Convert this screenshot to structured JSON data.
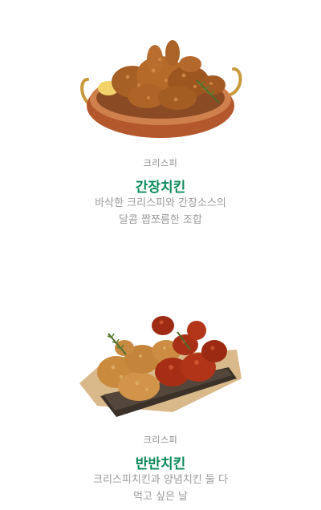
{
  "menu_items": [
    {
      "category": "크리스피",
      "name": "간장치킨",
      "description_line1": "바삭한 크리스피와 간장소스의",
      "description_line2": "달콤 짭쪼름한 조합",
      "image_icon": "soy-chicken-in-copper-pan-image"
    },
    {
      "category": "크리스피",
      "name": "반반치킨",
      "description_line1": "크리스피치킨과 양념치킨 둘 다",
      "description_line2": "먹고 싶은 날",
      "image_icon": "half-half-chicken-on-tray-image"
    }
  ],
  "colors": {
    "title_green": "#0b8a5b",
    "category_gray": "#8a8a8a",
    "description_gray": "#9a9a9a"
  }
}
